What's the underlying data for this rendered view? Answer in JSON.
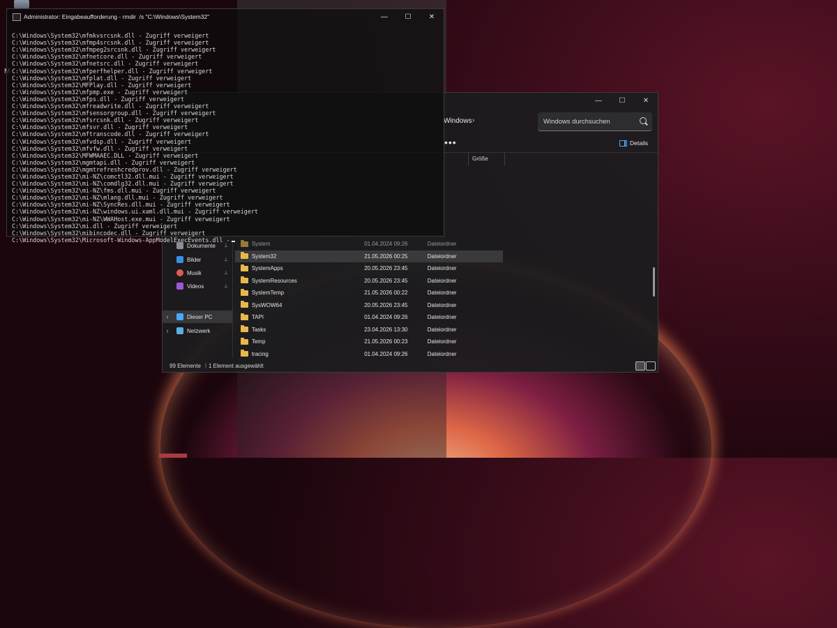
{
  "cmd": {
    "title": "Administrator: Eingabeaufforderung - rmdir  /s \"C:\\Windows\\System32\"",
    "controls": {
      "minimize": "—",
      "maximize": "☐",
      "close": "✕"
    },
    "lines": [
      "C:\\Windows\\System32\\mfmkvsrcsnk.dll - Zugriff verweigert",
      "C:\\Windows\\System32\\mfmp4srcsnk.dll - Zugriff verweigert",
      "C:\\Windows\\System32\\mfmpeg2srcsnk.dll - Zugriff verweigert",
      "C:\\Windows\\System32\\mfnetcore.dll - Zugriff verweigert",
      "C:\\Windows\\System32\\mfnetsrc.dll - Zugriff verweigert",
      "C:\\Windows\\System32\\mfperfhelper.dll - Zugriff verweigert",
      "C:\\Windows\\System32\\mfplat.dll - Zugriff verweigert",
      "C:\\Windows\\System32\\MFPlay.dll - Zugriff verweigert",
      "C:\\Windows\\System32\\mfpmp.exe - Zugriff verweigert",
      "C:\\Windows\\System32\\mfps.dll - Zugriff verweigert",
      "C:\\Windows\\System32\\mfreadwrite.dll - Zugriff verweigert",
      "C:\\Windows\\System32\\mfsensorgroup.dll - Zugriff verweigert",
      "C:\\Windows\\System32\\mfsrcsnk.dll - Zugriff verweigert",
      "C:\\Windows\\System32\\mfsvr.dll - Zugriff verweigert",
      "C:\\Windows\\System32\\mftranscode.dll - Zugriff verweigert",
      "C:\\Windows\\System32\\mfvdsp.dll - Zugriff verweigert",
      "C:\\Windows\\System32\\mfvfw.dll - Zugriff verweigert",
      "C:\\Windows\\System32\\MFWMAAEC.DLL - Zugriff verweigert",
      "C:\\Windows\\System32\\mgmtapi.dll - Zugriff verweigert",
      "C:\\Windows\\System32\\mgmtrefreshcredprov.dll - Zugriff verweigert",
      "C:\\Windows\\System32\\mi-NZ\\comctl32.dll.mui - Zugriff verweigert",
      "C:\\Windows\\System32\\mi-NZ\\comdlg32.dll.mui - Zugriff verweigert",
      "C:\\Windows\\System32\\mi-NZ\\fms.dll.mui - Zugriff verweigert",
      "C:\\Windows\\System32\\mi-NZ\\mlang.dll.mui - Zugriff verweigert",
      "C:\\Windows\\System32\\mi-NZ\\SyncRes.dll.mui - Zugriff verweigert",
      "C:\\Windows\\System32\\mi-NZ\\windows.ui.xaml.dll.mui - Zugriff verweigert",
      "C:\\Windows\\System32\\mi-NZ\\WWAHost.exe.mui - Zugriff verweigert",
      "C:\\Windows\\System32\\mi.dll - Zugriff verweigert",
      "C:\\Windows\\System32\\mibincodec.dll - Zugriff verweigert",
      "C:\\Windows\\System32\\Microsoft-Windows-AppModelExecEvents.dll -"
    ]
  },
  "explorer": {
    "controls": {
      "minimize": "—",
      "maximize": "☐",
      "close": "✕"
    },
    "breadcrumb": "Windows",
    "breadcrumb_chevron": "›",
    "search_placeholder": "Windows durchsuchen",
    "more_label": "•••",
    "details_label": "Details",
    "column_size": "Größe",
    "nav": [
      {
        "label": "Dokumente",
        "icon": "documents-icon",
        "color": "#8a8f98",
        "pin": "📌"
      },
      {
        "label": "Bilder",
        "icon": "pictures-icon",
        "color": "#3a8ee6",
        "pin": "📌"
      },
      {
        "label": "Musik",
        "icon": "music-icon",
        "color": "#e05a5a",
        "pin": "📌"
      },
      {
        "label": "Videos",
        "icon": "videos-icon",
        "color": "#9b59d9",
        "pin": "📌"
      },
      {
        "label": "Dieser PC",
        "icon": "pc-icon",
        "color": "#4aa8ff",
        "chevron": "›"
      },
      {
        "label": "Netzwerk",
        "icon": "network-icon",
        "color": "#5ab0e0",
        "chevron": "›"
      }
    ],
    "files": [
      {
        "name": "System",
        "date": "01.04.2024 09:26",
        "type": "Dateiordner"
      },
      {
        "name": "System32",
        "date": "21.05.2026 00:25",
        "type": "Dateiordner"
      },
      {
        "name": "SystemApps",
        "date": "20.05.2026 23:45",
        "type": "Dateiordner"
      },
      {
        "name": "SystemResources",
        "date": "20.05.2026 23:45",
        "type": "Dateiordner"
      },
      {
        "name": "SystemTemp",
        "date": "21.05.2026 00:22",
        "type": "Dateiordner"
      },
      {
        "name": "SysWOW64",
        "date": "20.05.2026 23:45",
        "type": "Dateiordner"
      },
      {
        "name": "TAPI",
        "date": "01.04.2024 09:26",
        "type": "Dateiordner"
      },
      {
        "name": "Tasks",
        "date": "23.04.2026 13:30",
        "type": "Dateiordner"
      },
      {
        "name": "Temp",
        "date": "21.05.2026 00:23",
        "type": "Dateiordner"
      },
      {
        "name": "tracing",
        "date": "01.04.2024 09:26",
        "type": "Dateiordner"
      }
    ],
    "status_count": "99 Elemente",
    "status_selected": "1 Element ausgewählt",
    "status_sep": "|"
  },
  "desktop": {
    "letter": "M"
  },
  "colors": {
    "accent": "#4aa8ff",
    "folder": "#e8b84a"
  }
}
